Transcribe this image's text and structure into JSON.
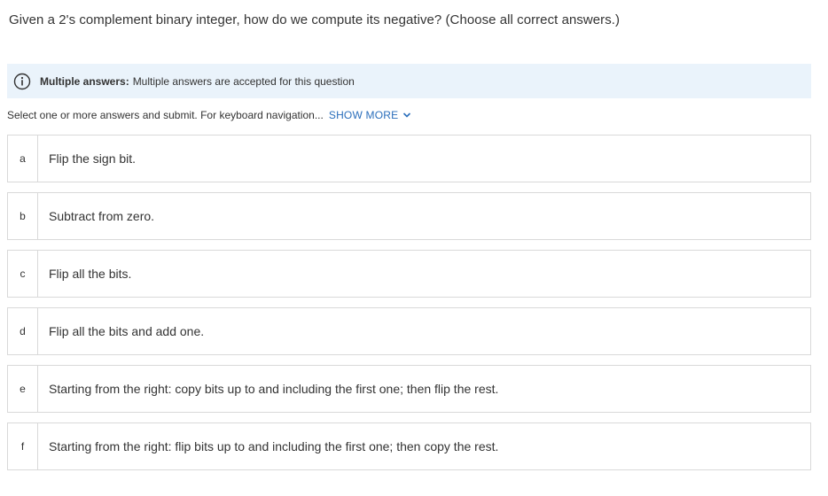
{
  "question": {
    "text": "Given a 2's complement binary integer, how do we compute its negative? (Choose all correct answers.)"
  },
  "info_banner": {
    "icon": "info-icon",
    "bold_label": "Multiple answers:",
    "text": "Multiple answers are accepted for this question",
    "background_color": "#eaf3fb"
  },
  "instructions": {
    "text": "Select one or more answers and submit. For keyboard navigation...",
    "show_more_label": "SHOW MORE",
    "show_more_icon": "chevron-down-icon",
    "link_color": "#2a6ebb"
  },
  "options": [
    {
      "letter": "a",
      "text": "Flip the sign bit."
    },
    {
      "letter": "b",
      "text": "Subtract from zero."
    },
    {
      "letter": "c",
      "text": "Flip all the bits."
    },
    {
      "letter": "d",
      "text": "Flip all the bits and add one."
    },
    {
      "letter": "e",
      "text": "Starting from the right: copy bits up to and including the first one; then flip the rest."
    },
    {
      "letter": "f",
      "text": "Starting from the right: flip bits up to and including the first one; then copy the rest."
    }
  ]
}
